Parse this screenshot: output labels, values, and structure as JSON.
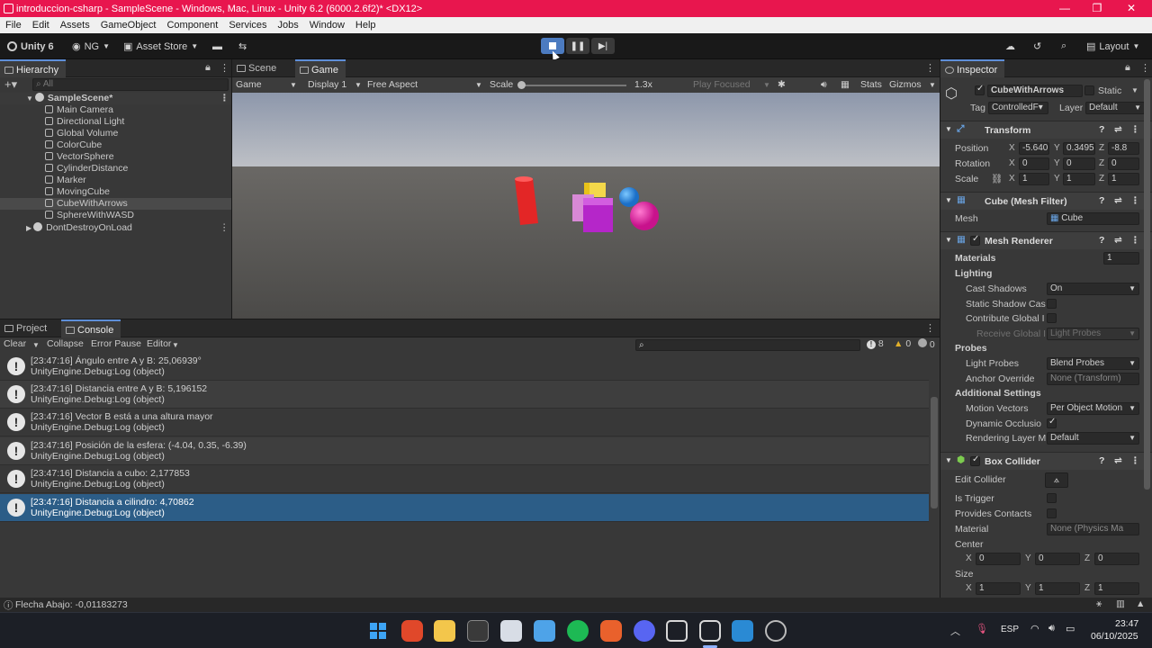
{
  "window": {
    "title": "introduccion-csharp - SampleScene - Windows, Mac, Linux - Unity 6.2 (6000.2.6f2)* <DX12>"
  },
  "menu": [
    "File",
    "Edit",
    "Assets",
    "GameObject",
    "Component",
    "Services",
    "Jobs",
    "Window",
    "Help"
  ],
  "toolbar": {
    "unity_label": "Unity 6",
    "account": "NG",
    "asset_store": "Asset Store",
    "layout": "Layout"
  },
  "hierarchy": {
    "tab": "Hierarchy",
    "search_placeholder": "All",
    "scene": "SampleScene*",
    "items": [
      "Main Camera",
      "Directional Light",
      "Global Volume",
      "ColorCube",
      "VectorSphere",
      "CylinderDistance",
      "Marker",
      "MovingCube",
      "CubeWithArrows",
      "SphereWithWASD"
    ],
    "ddol": "DontDestroyOnLoad"
  },
  "game": {
    "tabs": [
      "Scene",
      "Game"
    ],
    "display_mode": "Game",
    "display": "Display 1",
    "aspect": "Free Aspect",
    "scale_label": "Scale",
    "scale_value": "1.3x",
    "play_focused": "Play Focused",
    "stats": "Stats",
    "gizmos": "Gizmos"
  },
  "console": {
    "tabs": [
      "Project",
      "Console"
    ],
    "clear": "Clear",
    "collapse": "Collapse",
    "error_pause": "Error Pause",
    "editor": "Editor",
    "count_logs": "8",
    "count_warn": "0",
    "count_err": "0",
    "entries": [
      {
        "msg": "[23:47:16] Ángulo entre A y B: 25,06939°",
        "src": "UnityEngine.Debug:Log (object)"
      },
      {
        "msg": "[23:47:16] Distancia entre A y B: 5,196152",
        "src": "UnityEngine.Debug:Log (object)"
      },
      {
        "msg": "[23:47:16] Vector B está a una altura mayor",
        "src": "UnityEngine.Debug:Log (object)"
      },
      {
        "msg": "[23:47:16] Posición de la esfera: (-4.04, 0.35, -6.39)",
        "src": "UnityEngine.Debug:Log (object)"
      },
      {
        "msg": "[23:47:16] Distancia a cubo: 2,177853",
        "src": "UnityEngine.Debug:Log (object)"
      },
      {
        "msg": "[23:47:16] Distancia a cilindro: 4,70862",
        "src": "UnityEngine.Debug:Log (object)"
      }
    ]
  },
  "inspector": {
    "tab": "Inspector",
    "object_name": "CubeWithArrows",
    "static": "Static",
    "tag_label": "Tag",
    "tag": "ControlledF▾",
    "layer_label": "Layer",
    "layer": "Default",
    "transform": {
      "title": "Transform",
      "position": "Position",
      "rotation": "Rotation",
      "scale": "Scale",
      "pos": [
        "-5.640",
        "0.3495",
        "-8.8"
      ],
      "rot": [
        "0",
        "0",
        "0"
      ],
      "scl": [
        "1",
        "1",
        "1"
      ]
    },
    "mesh_filter": {
      "title": "Cube (Mesh Filter)",
      "mesh_label": "Mesh",
      "mesh": "Cube"
    },
    "mesh_renderer": {
      "title": "Mesh Renderer",
      "materials": "Materials",
      "materials_count": "1",
      "lighting": "Lighting",
      "cast_shadows": "Cast Shadows",
      "cast_shadows_val": "On",
      "static_shadow": "Static Shadow Cas",
      "contribute_gi": "Contribute Global I",
      "receive_gi": "Receive Global I",
      "receive_gi_val": "Light Probes",
      "probes": "Probes",
      "light_probes": "Light Probes",
      "light_probes_val": "Blend Probes",
      "anchor_override": "Anchor Override",
      "anchor_val": "None (Transform)",
      "additional": "Additional Settings",
      "motion_vectors": "Motion Vectors",
      "motion_val": "Per Object Motion",
      "dynamic_occ": "Dynamic Occlusio",
      "rendering_layer": "Rendering Layer M",
      "rendering_val": "Default"
    },
    "box_collider": {
      "title": "Box Collider",
      "edit_collider": "Edit Collider",
      "is_trigger": "Is Trigger",
      "provides_contacts": "Provides Contacts",
      "material": "Material",
      "material_val": "None (Physics Ma",
      "center": "Center",
      "center_vals": [
        "0",
        "0",
        "0"
      ],
      "size": "Size",
      "size_vals": [
        "1",
        "1",
        "1"
      ]
    }
  },
  "status": {
    "text": "Flecha Abajo: -0,01183273"
  },
  "taskbar": {
    "lang": "ESP",
    "time": "23:47",
    "date": "06/10/2025"
  },
  "colors": {
    "title_bar": "#e8164e",
    "selection": "#2c5d87",
    "play_active": "#4c7bc0"
  }
}
